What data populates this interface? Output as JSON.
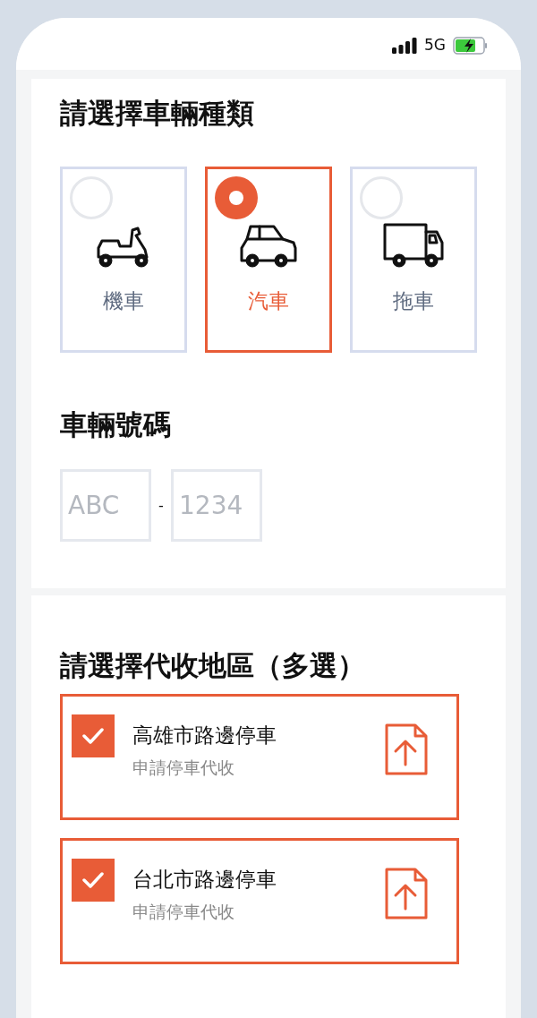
{
  "status_bar": {
    "network": "5G"
  },
  "vehicle_type": {
    "title": "請選擇車輛種類",
    "options": [
      {
        "kind": "scooter",
        "label": "機車",
        "selected": false
      },
      {
        "kind": "car",
        "label": "汽車",
        "selected": true
      },
      {
        "kind": "truck",
        "label": "拖車",
        "selected": false
      }
    ]
  },
  "plate_number": {
    "title": "車輛號碼",
    "fields": [
      {
        "placeholder": "ABC"
      },
      {
        "placeholder": "1234"
      }
    ],
    "separator": "-"
  },
  "collection_areas": {
    "title": "請選擇代收地區（多選）",
    "items": [
      {
        "title": "高雄市路邊停車",
        "subtitle": "申請停車代收",
        "checked": true
      },
      {
        "title": "台北市路邊停車",
        "subtitle": "申請停車代收",
        "checked": true
      }
    ]
  }
}
